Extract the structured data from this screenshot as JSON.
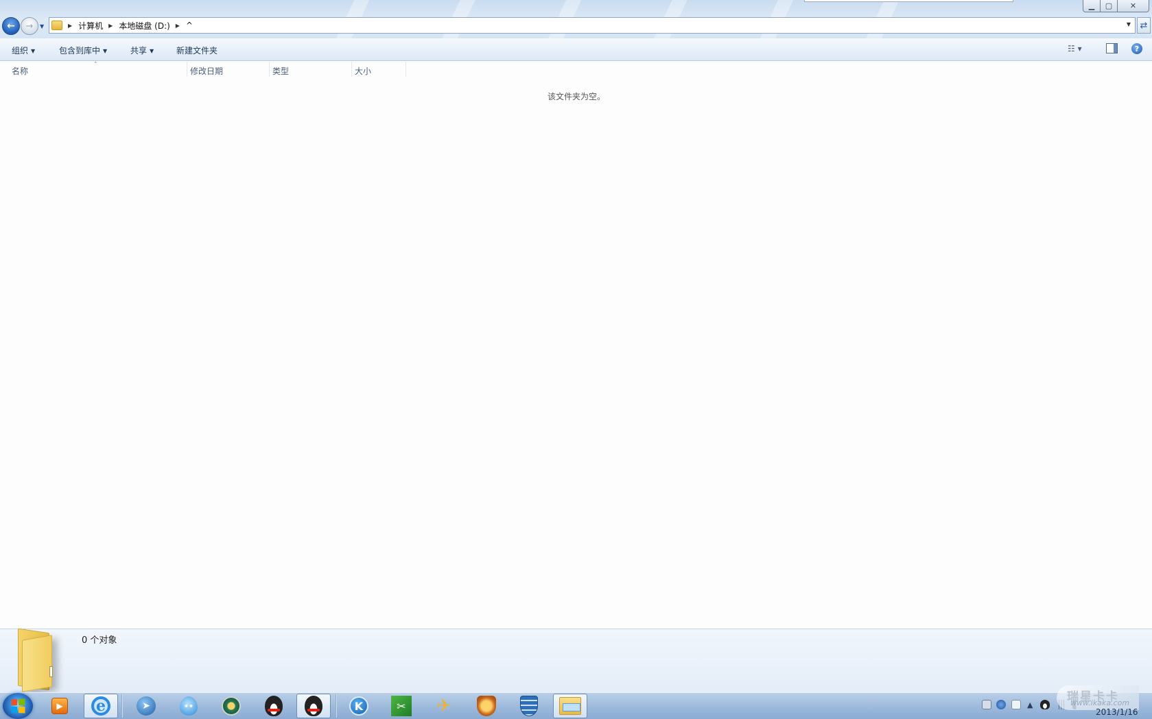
{
  "window": {
    "minimize_glyph": "▁",
    "maximize_glyph": "▢",
    "close_glyph": "✕"
  },
  "nav": {
    "back_glyph": "←",
    "forward_glyph": "→",
    "history_glyph": "▼"
  },
  "address": {
    "crumbs": [
      "计算机",
      "本地磁盘 (D:)",
      "^"
    ],
    "sep_glyph": "▶",
    "dropdown_glyph": "▼",
    "refresh_glyph": "⇄"
  },
  "toolbar": {
    "organize_label": "组织",
    "include_library_label": "包含到库中",
    "share_label": "共享",
    "new_folder_label": "新建文件夹",
    "menu_arrow": "▼",
    "view_glyph": "☷ ▾",
    "help_glyph": "?"
  },
  "columns": {
    "name": "名称",
    "modified": "修改日期",
    "type": "类型",
    "size": "大小",
    "sort_glyph": "˄"
  },
  "content": {
    "empty_message": "该文件夹为空。"
  },
  "details": {
    "object_count": "0 个对象"
  },
  "taskbar": {
    "clock_date": "2013/1/16",
    "tray_arrow": "▲",
    "pinned": [
      {
        "name": "media-player",
        "glyph": "▶"
      },
      {
        "name": "internet-explorer",
        "glyph": "e"
      },
      {
        "name": "messenger",
        "glyph": "➤"
      },
      {
        "name": "drop-app",
        "glyph": "••"
      },
      {
        "name": "badge-app",
        "glyph": ""
      },
      {
        "name": "qq-game",
        "glyph": ""
      },
      {
        "name": "qq",
        "glyph": ""
      },
      {
        "name": "kugou",
        "glyph": "K"
      },
      {
        "name": "green-app",
        "glyph": "✂"
      },
      {
        "name": "bird-app",
        "glyph": "✈"
      },
      {
        "name": "lion-app",
        "glyph": ""
      },
      {
        "name": "shield-app",
        "glyph": ""
      },
      {
        "name": "explorer",
        "glyph": ""
      }
    ]
  },
  "watermark": {
    "title": "瑞星卡卡",
    "url": "www.ikaka.com"
  },
  "colors": {
    "chrome_blue": "#d3e3f3",
    "taskbar_blue": "#9fbbdc",
    "link_text": "#1e395b"
  }
}
